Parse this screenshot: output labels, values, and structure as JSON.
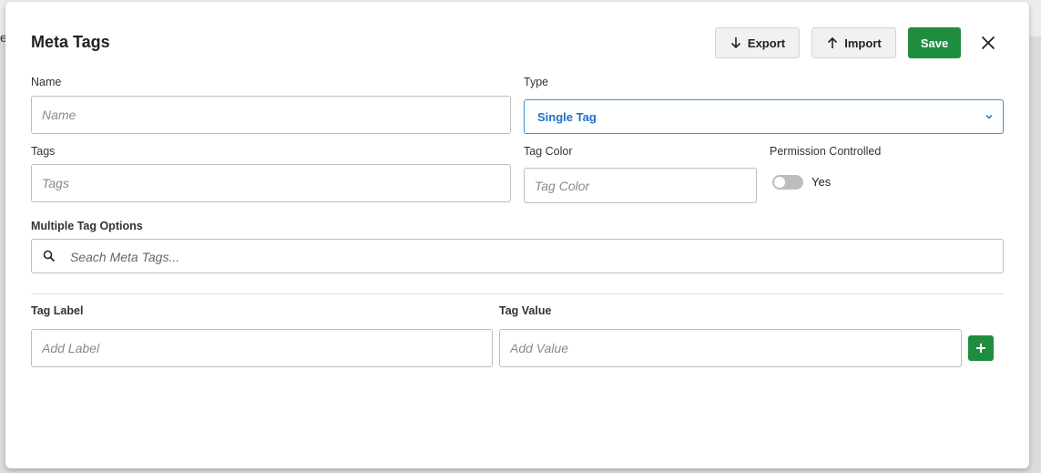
{
  "modal": {
    "title": "Meta Tags",
    "export_label": "Export",
    "import_label": "Import",
    "save_label": "Save"
  },
  "fields": {
    "name": {
      "label": "Name",
      "placeholder": "Name",
      "value": ""
    },
    "type": {
      "label": "Type",
      "value": "Single Tag"
    },
    "tags": {
      "label": "Tags",
      "placeholder": "Tags",
      "value": ""
    },
    "tag_color": {
      "label": "Tag Color",
      "placeholder": "Tag Color",
      "value": ""
    },
    "permission": {
      "label": "Permission Controlled",
      "toggle_text": "Yes",
      "on": false
    }
  },
  "options": {
    "label": "Multiple Tag Options",
    "search_placeholder": "Seach Meta Tags..."
  },
  "tag_entry": {
    "label_header": "Tag Label",
    "value_header": "Tag Value",
    "label_placeholder": "Add Label",
    "value_placeholder": "Add Value"
  },
  "colors": {
    "accent_green": "#1e8e3e",
    "select_blue": "#1a73c9"
  },
  "icons": {
    "export": "arrow-down-icon",
    "import": "arrow-up-icon",
    "close": "close-icon",
    "select": "chevron-down-icon",
    "search": "search-icon",
    "add": "plus-icon"
  }
}
